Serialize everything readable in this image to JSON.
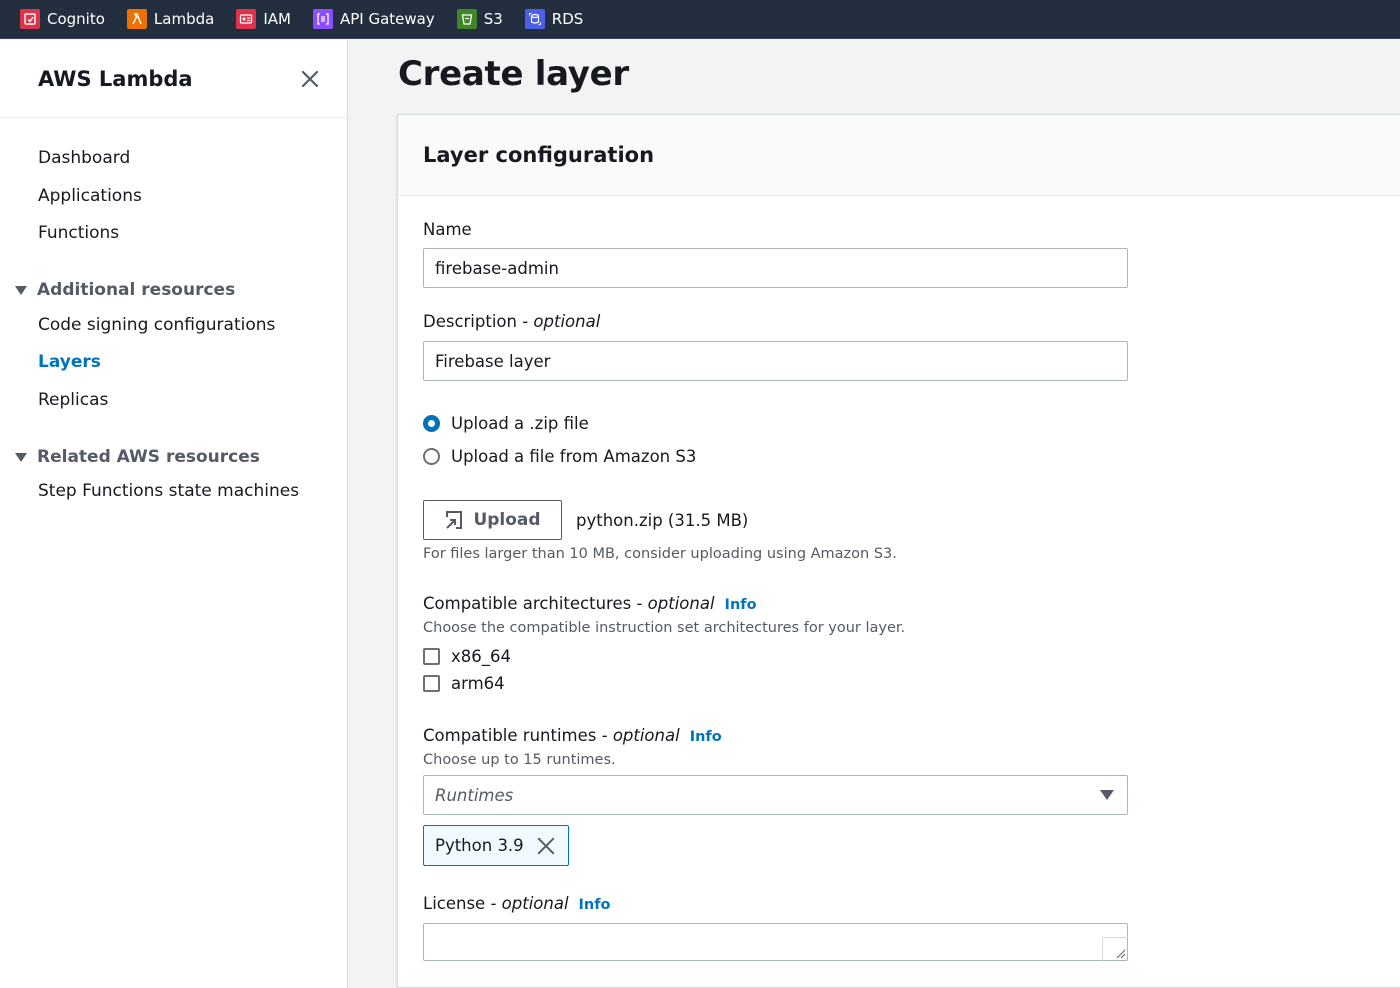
{
  "topbar": {
    "services": [
      {
        "label": "Cognito",
        "icon": "cognito-icon",
        "color": "#dd344c"
      },
      {
        "label": "Lambda",
        "icon": "lambda-icon",
        "color": "#ed7100"
      },
      {
        "label": "IAM",
        "icon": "iam-icon",
        "color": "#dd344c"
      },
      {
        "label": "API Gateway",
        "icon": "api-gateway-icon",
        "color": "#8c4fff"
      },
      {
        "label": "S3",
        "icon": "s3-icon",
        "color": "#3f8624"
      },
      {
        "label": "RDS",
        "icon": "rds-icon",
        "color": "#4b5fe8"
      }
    ]
  },
  "sidebar": {
    "title": "AWS Lambda",
    "items": [
      "Dashboard",
      "Applications",
      "Functions"
    ],
    "sections": [
      {
        "label": "Additional resources",
        "items": [
          "Code signing configurations",
          "Layers",
          "Replicas"
        ]
      },
      {
        "label": "Related AWS resources",
        "items": [
          "Step Functions state machines"
        ]
      }
    ],
    "active_item": "Layers"
  },
  "page": {
    "title": "Create layer"
  },
  "form": {
    "panel_title": "Layer configuration",
    "name_label": "Name",
    "name_value": "firebase-admin",
    "description_label": "Description - ",
    "optional": "optional",
    "description_value": "Firebase layer",
    "upload_options": [
      "Upload a .zip file",
      "Upload a file from Amazon S3"
    ],
    "upload_selected": 0,
    "upload_button": "Upload",
    "file_name": "python.zip (31.5 MB)",
    "upload_hint": "For files larger than 10 MB, consider uploading using Amazon S3.",
    "architectures_label": "Compatible architectures - ",
    "info": "Info",
    "architectures_hint": "Choose the compatible instruction set architectures for your layer.",
    "architectures": [
      "x86_64",
      "arm64"
    ],
    "runtimes_label": "Compatible runtimes - ",
    "runtimes_hint": "Choose up to 15 runtimes.",
    "runtimes_placeholder": "Runtimes",
    "selected_runtime": "Python 3.9",
    "license_label": "License - "
  }
}
